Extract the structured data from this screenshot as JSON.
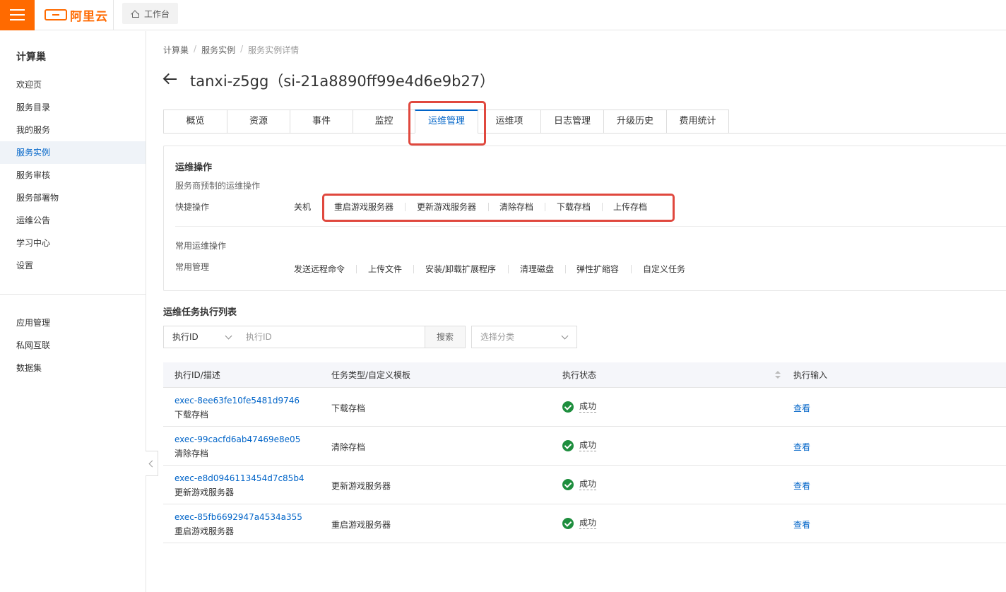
{
  "header": {
    "logo_text": "阿里云",
    "workbench_label": "工作台"
  },
  "sidebar": {
    "title": "计算巢",
    "items": [
      {
        "label": "欢迎页"
      },
      {
        "label": "服务目录"
      },
      {
        "label": "我的服务"
      },
      {
        "label": "服务实例",
        "active": true
      },
      {
        "label": "服务审核"
      },
      {
        "label": "服务部署物"
      },
      {
        "label": "运维公告"
      },
      {
        "label": "学习中心"
      },
      {
        "label": "设置"
      }
    ],
    "secondary_items": [
      {
        "label": "应用管理"
      },
      {
        "label": "私网互联"
      },
      {
        "label": "数据集"
      }
    ]
  },
  "breadcrumb": [
    "计算巢",
    "服务实例",
    "服务实例详情"
  ],
  "page_title": "tanxi-z5gg（si-21a8890ff99e4d6e9b27）",
  "tabs": [
    {
      "label": "概览"
    },
    {
      "label": "资源"
    },
    {
      "label": "事件"
    },
    {
      "label": "监控"
    },
    {
      "label": "运维管理",
      "active": true
    },
    {
      "label": "运维项"
    },
    {
      "label": "日志管理"
    },
    {
      "label": "升级历史"
    },
    {
      "label": "费用统计"
    }
  ],
  "ops": {
    "title": "运维操作",
    "subtitle": "服务商预制的运维操作",
    "quick_label": "快捷操作",
    "quick_actions": [
      "关机",
      "重启游戏服务器",
      "更新游戏服务器",
      "清除存档",
      "下载存档",
      "上传存档"
    ],
    "common_section": "常用运维操作",
    "common_label": "常用管理",
    "common_actions": [
      "发送远程命令",
      "上传文件",
      "安装/卸载扩展程序",
      "清理磁盘",
      "弹性扩缩容",
      "自定义任务"
    ]
  },
  "task_list": {
    "title": "运维任务执行列表",
    "filter_select": "执行ID",
    "filter_placeholder": "执行ID",
    "search_label": "搜索",
    "category_placeholder": "选择分类",
    "columns": [
      "执行ID/描述",
      "任务类型/自定义模板",
      "执行状态",
      "执行输入"
    ],
    "rows": [
      {
        "id": "exec-8ee63fe10fe5481d9746",
        "desc": "下载存档",
        "type": "下载存档",
        "status": "成功",
        "action": "查看"
      },
      {
        "id": "exec-99cacfd6ab47469e8e05",
        "desc": "清除存档",
        "type": "清除存档",
        "status": "成功",
        "action": "查看"
      },
      {
        "id": "exec-e8d0946113454d7c85b4",
        "desc": "更新游戏服务器",
        "type": "更新游戏服务器",
        "status": "成功",
        "action": "查看"
      },
      {
        "id": "exec-85fb6692947a4534a355",
        "desc": "重启游戏服务器",
        "type": "重启游戏服务器",
        "status": "成功",
        "action": "查看"
      }
    ]
  },
  "colors": {
    "brand": "#ff6a00",
    "link": "#0064c8",
    "success": "#1e8e3e",
    "highlight": "#e0483e"
  }
}
